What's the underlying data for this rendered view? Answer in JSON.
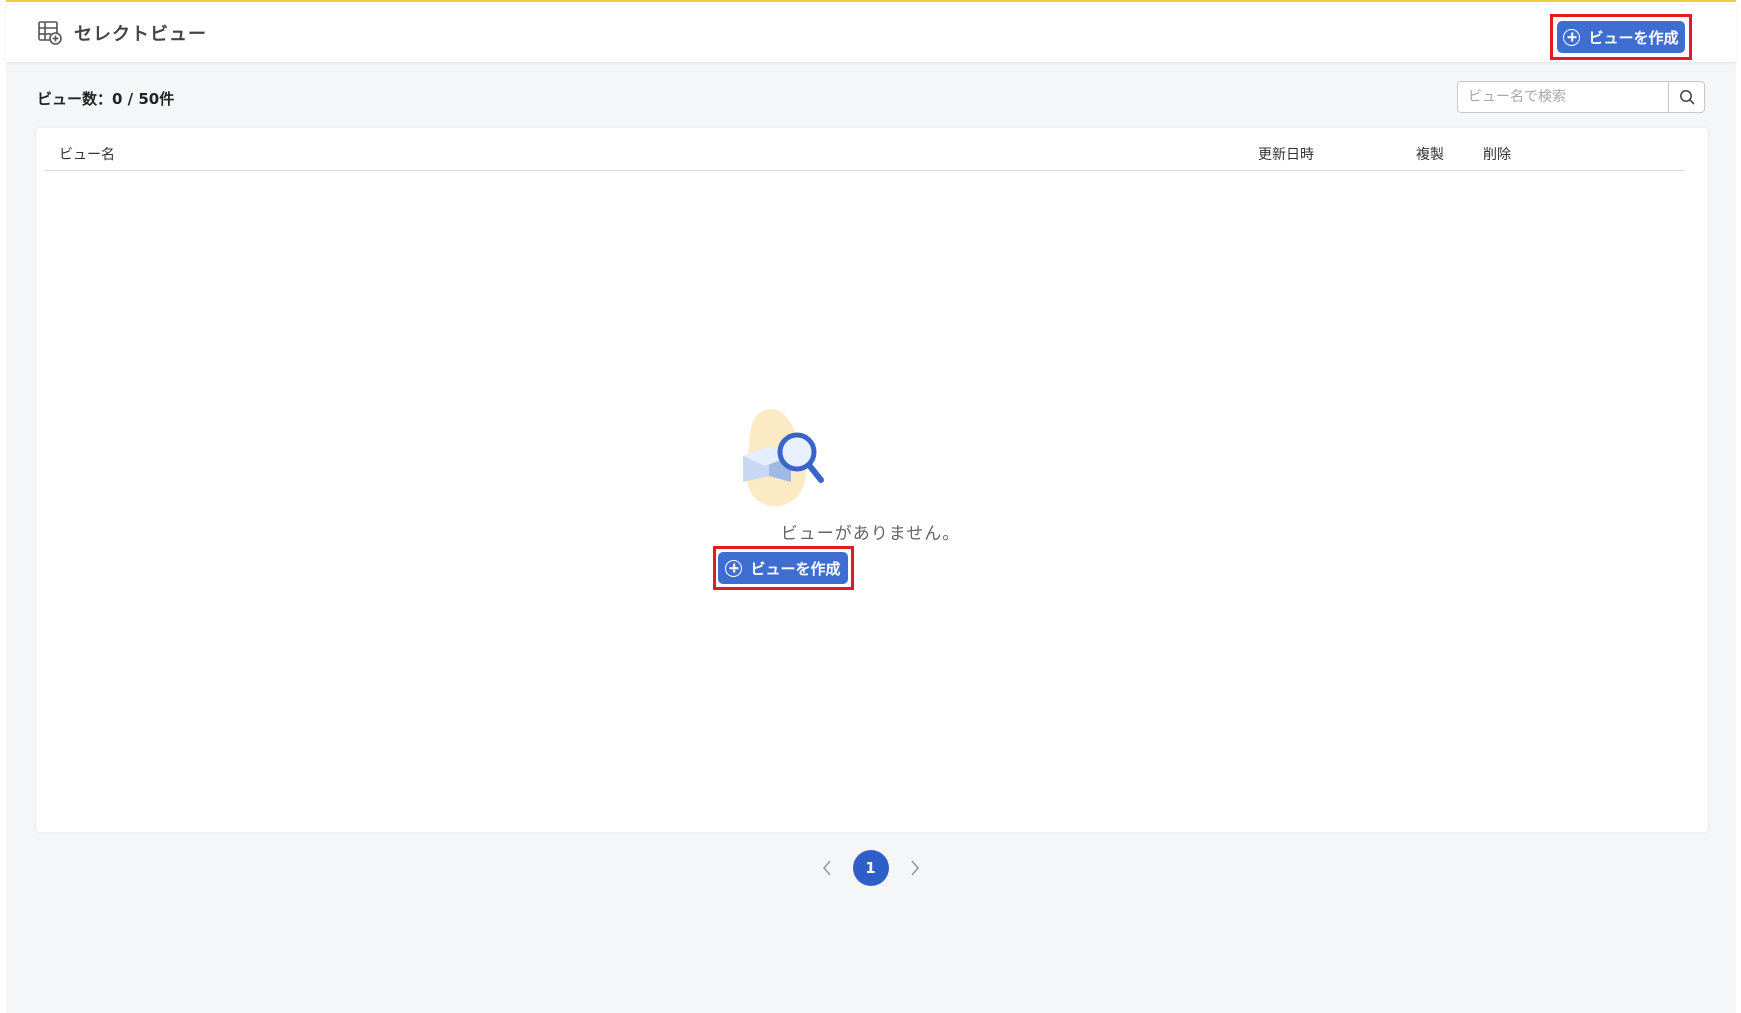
{
  "header": {
    "icon": "table-add-icon",
    "title": "セレクトビュー",
    "create_button_label": "ビューを作成"
  },
  "toolbar": {
    "count_label": "ビュー数：0 / 50件",
    "search_placeholder": "ビュー名で検索",
    "search_icon": "search-icon"
  },
  "table": {
    "columns": [
      "ビュー名",
      "更新日時",
      "複製",
      "削除"
    ]
  },
  "empty_state": {
    "illustration": "empty-box-search-icon",
    "message": "ビューがありません。",
    "create_button_label": "ビューを作成"
  },
  "pagination": {
    "current_page": "1"
  },
  "colors": {
    "accent": "#3f6ed0",
    "highlight_border": "#e31b23",
    "top_border": "#f2cf3e"
  }
}
